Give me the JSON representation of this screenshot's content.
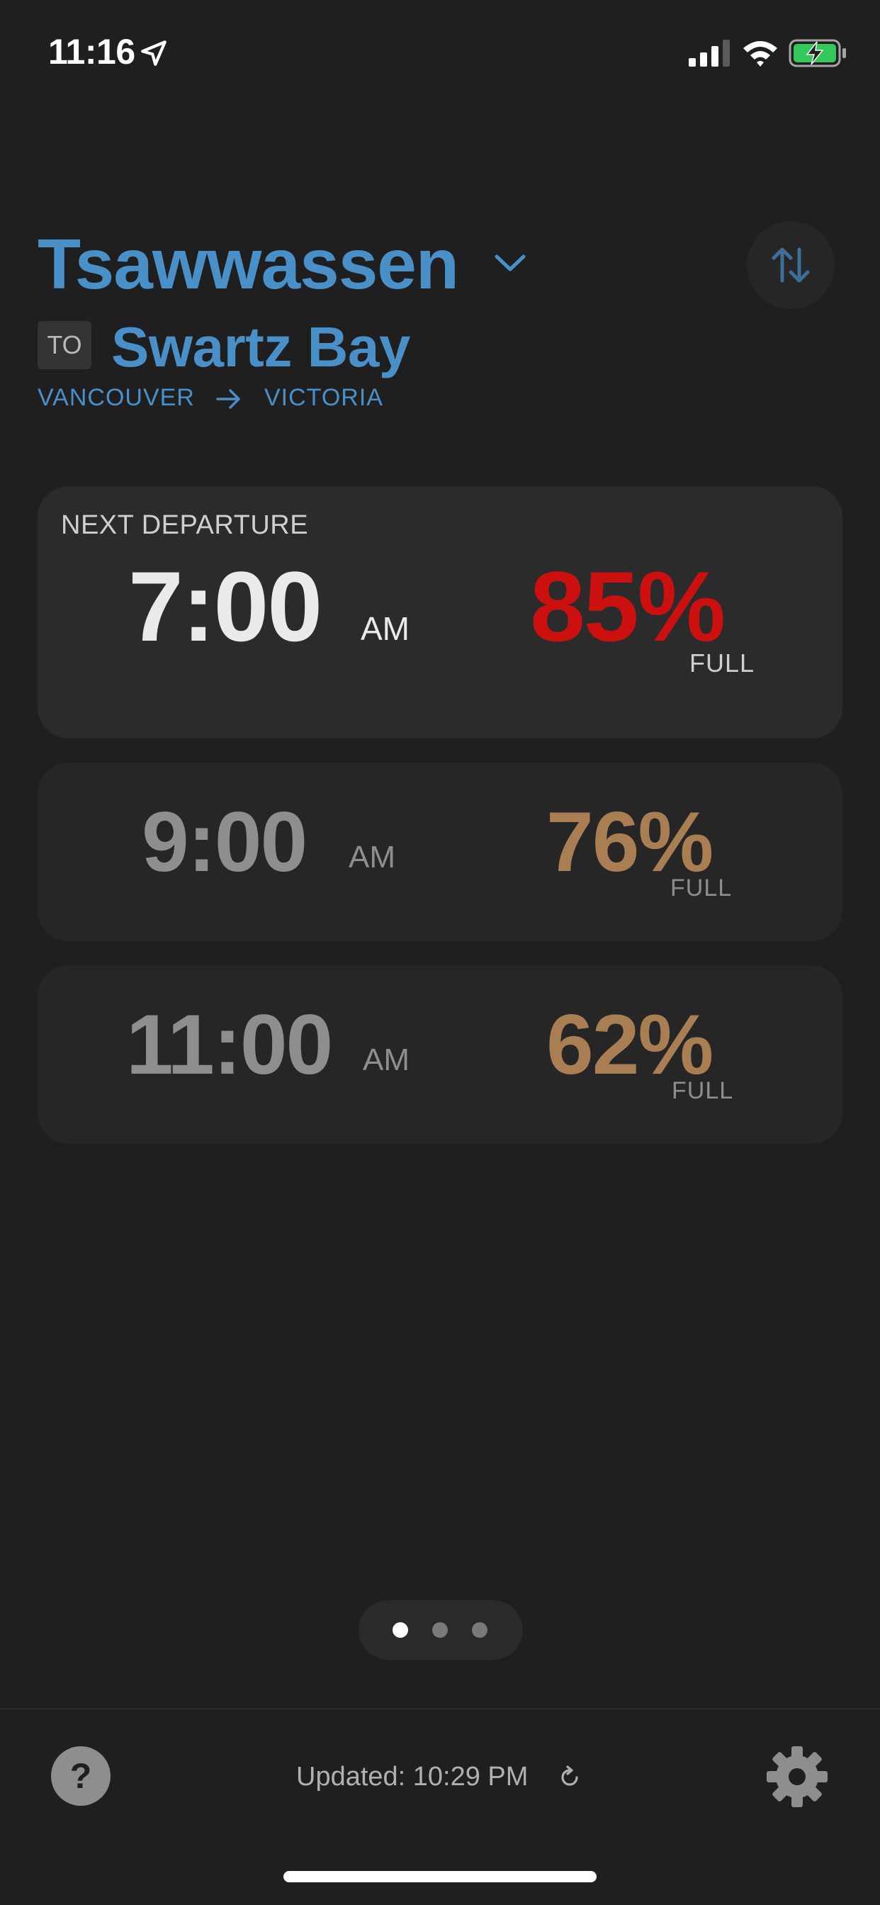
{
  "status_bar": {
    "time": "11:16",
    "icons": [
      "location-arrow-icon",
      "cellular-signal-icon",
      "wifi-icon",
      "battery-charging-icon"
    ]
  },
  "route": {
    "origin": "Tsawwassen",
    "to_label": "TO",
    "destination": "Swartz Bay",
    "from_city": "VANCOUVER",
    "to_city": "VICTORIA"
  },
  "sailings": [
    {
      "label": "NEXT DEPARTURE",
      "time": "7:00",
      "ampm": "AM",
      "capacity": "85%",
      "capacity_value": 85,
      "capacity_label": "FULL",
      "color": "#cc1010"
    },
    {
      "time": "9:00",
      "ampm": "AM",
      "capacity": "76%",
      "capacity_value": 76,
      "capacity_label": "FULL",
      "color": "#a87e52"
    },
    {
      "time": "11:00",
      "ampm": "AM",
      "capacity": "62%",
      "capacity_value": 62,
      "capacity_label": "FULL",
      "color": "#a87e52"
    }
  ],
  "pagination": {
    "pages": 3,
    "current": 1
  },
  "footer": {
    "updated": "Updated: 10:29 PM"
  },
  "colors": {
    "background": "#1f1f1f",
    "accent": "#4a90c8",
    "card": "#2b2b2b",
    "high_capacity": "#cc1010",
    "medium_capacity": "#a87e52"
  }
}
